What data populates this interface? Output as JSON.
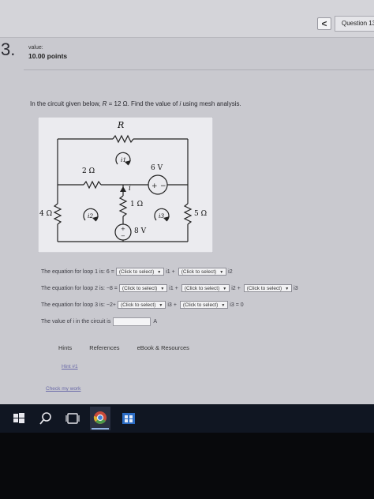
{
  "header": {
    "back_glyph": "<",
    "question_tab": "Question 13"
  },
  "question": {
    "number": "3.",
    "value_label": "value:",
    "points": "10.00 points",
    "prompt_a": "In the circuit given below, ",
    "prompt_r": "R",
    "prompt_b": " = 12 Ω. Find the value of ",
    "prompt_i": "i",
    "prompt_c": " using mesh analysis."
  },
  "circuit": {
    "r_label": "R",
    "r2_label": "2 Ω",
    "r1_label": "1 Ω",
    "r4_label": "4 Ω",
    "r5_label": "5 Ω",
    "v6_label": "6 V",
    "v8_label": "8 V",
    "i_label": "i",
    "i1_label": "i1",
    "i2_label": "i2",
    "i3_label": "i3"
  },
  "equations": {
    "loop1_prefix": "The equation for loop 1 is: 6 =",
    "loop2_prefix": "The equation for loop 2 is: −8 =",
    "loop3_prefix": "The equation for loop 3 is: −2+",
    "select_placeholder": "(Click to select)",
    "plus": "+",
    "i1": "i1",
    "i2": "i2",
    "i3": "i3",
    "i3_eq0": "i3 = 0",
    "value_prefix": "The value of i in the circuit is",
    "unit": "A"
  },
  "tabs": {
    "hints": "Hints",
    "references": "References",
    "ebook": "eBook & Resources"
  },
  "links": {
    "hint": "Hint #1",
    "check": "Check my work"
  },
  "taskbar": {
    "icons": [
      "windows-icon",
      "search-icon",
      "task-view-icon",
      "chrome-icon",
      "store-icon"
    ]
  },
  "colors": {
    "screen_bg": "#c9c9cf",
    "taskbar_bg": "#101622",
    "link": "#6a6aa8"
  }
}
